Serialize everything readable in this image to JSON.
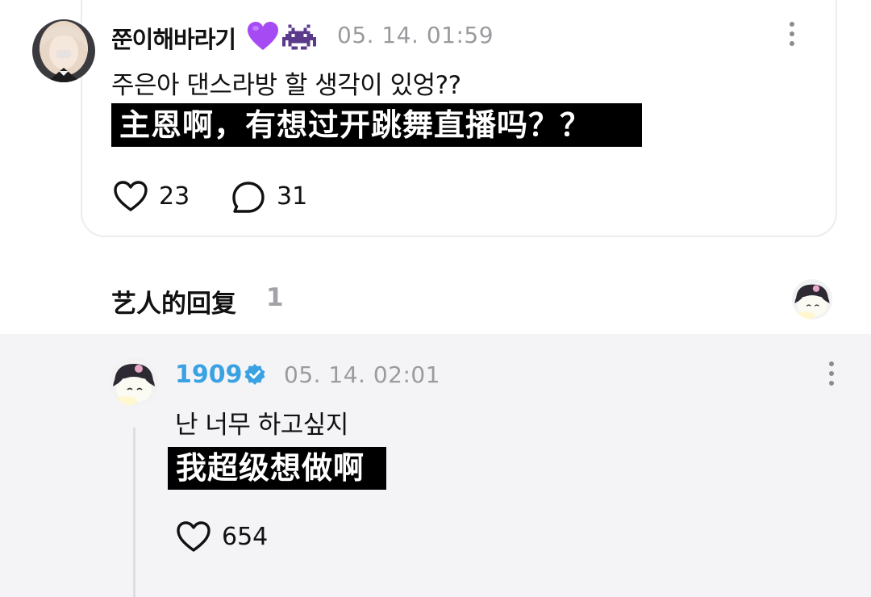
{
  "post": {
    "username": "쭌이해바라기",
    "username_emojis": [
      "purple-heart-icon",
      "space-invader-icon"
    ],
    "timestamp": "05. 14. 01:59",
    "text": "주은아 댄스라방 할 생각이 있엉??",
    "translation": "主恩啊，有想过开跳舞直播吗？？",
    "likes": "23",
    "comments": "31"
  },
  "section": {
    "title": "艺人的回复",
    "count": "1"
  },
  "reply": {
    "username": "1909",
    "timestamp": "05. 14. 02:01",
    "text": "난 너무 하고싶지",
    "translation": "我超级想做啊",
    "likes": "654"
  },
  "colors": {
    "artist_name": "#3aa2e3",
    "reply_background": "#f4f4f6",
    "timestamp": "#9b9b9f",
    "subtitle_bg": "#000000"
  }
}
